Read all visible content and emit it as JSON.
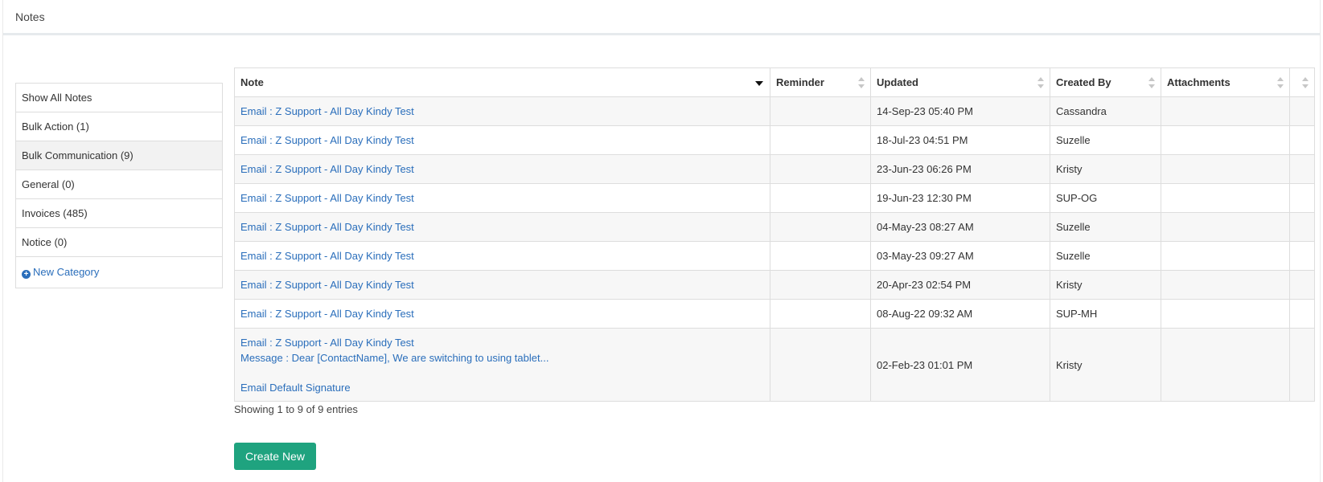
{
  "panel": {
    "title": "Notes"
  },
  "categories": [
    {
      "label": "Show All Notes"
    },
    {
      "label": "Bulk Action (1)"
    },
    {
      "label": "Bulk Communication (9)",
      "active": true
    },
    {
      "label": "General (0)"
    },
    {
      "label": "Invoices (485)"
    },
    {
      "label": "Notice (0)"
    }
  ],
  "new_category_label": "New Category",
  "table": {
    "columns": [
      "Note",
      "Reminder",
      "Updated",
      "Created By",
      "Attachments",
      ""
    ],
    "rows": [
      {
        "note": "Email : Z Support - All Day Kindy Test",
        "reminder": "",
        "updated": "14-Sep-23 05:40 PM",
        "created_by": "Cassandra",
        "attachments": ""
      },
      {
        "note": "Email : Z Support - All Day Kindy Test",
        "reminder": "",
        "updated": "18-Jul-23 04:51 PM",
        "created_by": "Suzelle",
        "attachments": ""
      },
      {
        "note": "Email : Z Support - All Day Kindy Test",
        "reminder": "",
        "updated": "23-Jun-23 06:26 PM",
        "created_by": "Kristy",
        "attachments": ""
      },
      {
        "note": "Email : Z Support - All Day Kindy Test",
        "reminder": "",
        "updated": "19-Jun-23 12:30 PM",
        "created_by": "SUP-OG",
        "attachments": ""
      },
      {
        "note": "Email : Z Support - All Day Kindy Test",
        "reminder": "",
        "updated": "04-May-23 08:27 AM",
        "created_by": "Suzelle",
        "attachments": ""
      },
      {
        "note": "Email : Z Support - All Day Kindy Test",
        "reminder": "",
        "updated": "03-May-23 09:27 AM",
        "created_by": "Suzelle",
        "attachments": ""
      },
      {
        "note": "Email : Z Support - All Day Kindy Test",
        "reminder": "",
        "updated": "20-Apr-23 02:54 PM",
        "created_by": "Kristy",
        "attachments": ""
      },
      {
        "note": "Email : Z Support - All Day Kindy Test",
        "reminder": "",
        "updated": "08-Aug-22 09:32 AM",
        "created_by": "SUP-MH",
        "attachments": ""
      },
      {
        "note": "Email : Z Support - All Day Kindy Test",
        "message": "Message : Dear [ContactName], We are switching to using tablet...",
        "signature": "Email Default Signature",
        "reminder": "",
        "updated": "02-Feb-23 01:01 PM",
        "created_by": "Kristy",
        "attachments": ""
      }
    ]
  },
  "info_text": "Showing 1 to 9 of 9 entries",
  "create_button_label": "Create New",
  "colors": {
    "link": "#2a6ebb",
    "primary_button": "#1fa37f"
  }
}
